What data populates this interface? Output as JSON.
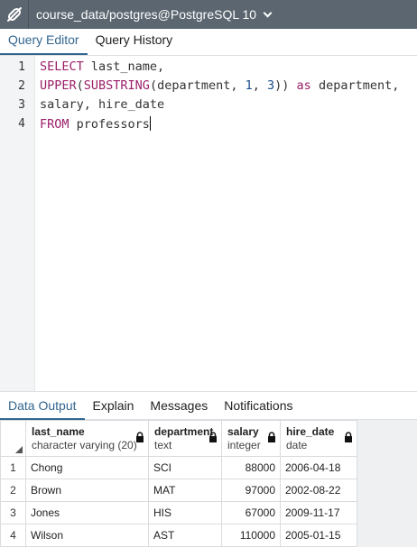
{
  "connection": {
    "title": "course_data/postgres@PostgreSQL 10"
  },
  "editor_tabs": [
    {
      "label": "Query Editor",
      "active": true
    },
    {
      "label": "Query History",
      "active": false
    }
  ],
  "editor": {
    "lines": [
      {
        "no": "1",
        "tokens": [
          {
            "t": "kw",
            "v": "SELECT"
          },
          {
            "t": "txt",
            "v": " last_name,"
          }
        ]
      },
      {
        "no": "2",
        "tokens": [
          {
            "t": "kw",
            "v": "UPPER"
          },
          {
            "t": "txt",
            "v": "("
          },
          {
            "t": "kw",
            "v": "SUBSTRING"
          },
          {
            "t": "txt",
            "v": "(department, "
          },
          {
            "t": "num",
            "v": "1"
          },
          {
            "t": "txt",
            "v": ", "
          },
          {
            "t": "num",
            "v": "3"
          },
          {
            "t": "txt",
            "v": ")) "
          },
          {
            "t": "kw",
            "v": "as"
          },
          {
            "t": "txt",
            "v": " department,"
          }
        ]
      },
      {
        "no": "3",
        "tokens": [
          {
            "t": "txt",
            "v": "salary, hire_date"
          }
        ]
      },
      {
        "no": "4",
        "tokens": [
          {
            "t": "kw",
            "v": "FROM"
          },
          {
            "t": "txt",
            "v": " professors"
          }
        ]
      }
    ]
  },
  "output_tabs": [
    {
      "label": "Data Output",
      "active": true
    },
    {
      "label": "Explain",
      "active": false
    },
    {
      "label": "Messages",
      "active": false
    },
    {
      "label": "Notifications",
      "active": false
    }
  ],
  "results": {
    "columns": [
      {
        "name": "last_name",
        "type": "character varying (20)",
        "align": "left"
      },
      {
        "name": "department",
        "type": "text",
        "align": "left"
      },
      {
        "name": "salary",
        "type": "integer",
        "align": "right"
      },
      {
        "name": "hire_date",
        "type": "date",
        "align": "left"
      }
    ],
    "rows": [
      {
        "n": "1",
        "cells": [
          "Chong",
          "SCI",
          "88000",
          "2006-04-18"
        ]
      },
      {
        "n": "2",
        "cells": [
          "Brown",
          "MAT",
          "97000",
          "2002-08-22"
        ]
      },
      {
        "n": "3",
        "cells": [
          "Jones",
          "HIS",
          "67000",
          "2009-11-17"
        ]
      },
      {
        "n": "4",
        "cells": [
          "Wilson",
          "AST",
          "110000",
          "2005-01-15"
        ]
      }
    ]
  },
  "colors": {
    "topbar": "#5b6670",
    "accent": "#326690",
    "keyword": "#9b1f6a",
    "number": "#1a4c8a"
  }
}
